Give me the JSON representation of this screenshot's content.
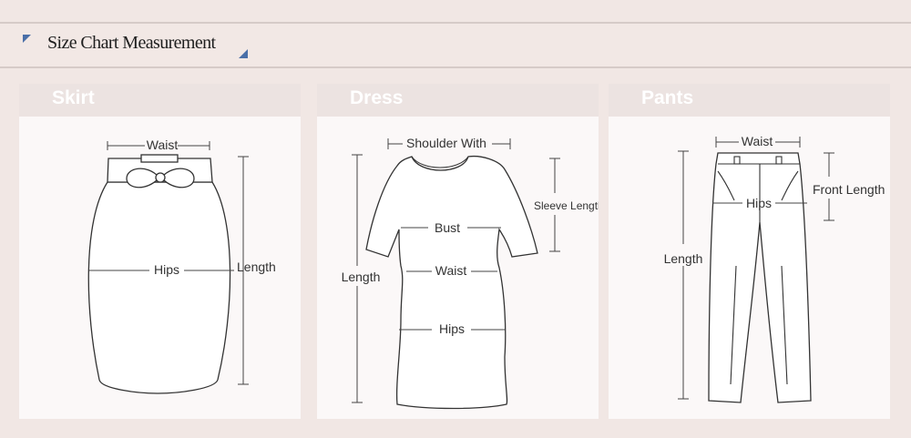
{
  "header": {
    "title": "Size Chart Measurement"
  },
  "panels": {
    "skirt": {
      "name": "Skirt",
      "waist": "Waist",
      "hips": "Hips",
      "length": "Length"
    },
    "dress": {
      "name": "Dress",
      "shoulder": "Shoulder With",
      "sleeve": "Sleeve Length",
      "bust": "Bust",
      "waist": "Waist",
      "hips": "Hips",
      "length": "Length"
    },
    "pants": {
      "name": "Pants",
      "waist": "Waist",
      "front_length": "Front Length",
      "hips": "Hips",
      "length": "Length"
    }
  },
  "colors": {
    "background": "#f1e7e4",
    "accent": "#4a6fa8",
    "panel": "#fbf8f8"
  }
}
